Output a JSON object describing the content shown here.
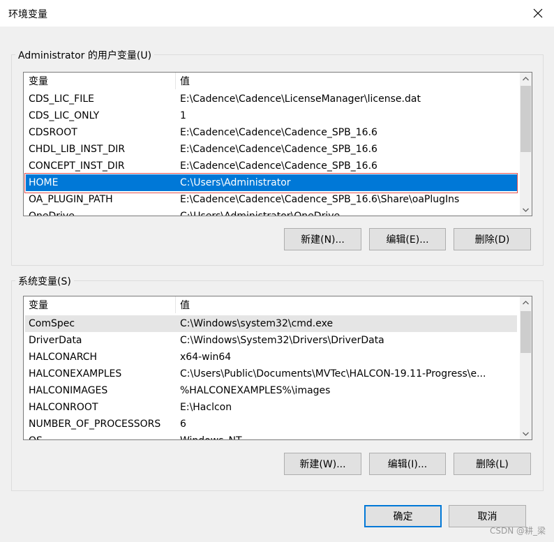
{
  "window": {
    "title": "环境变量"
  },
  "user_vars": {
    "group_label": "Administrator 的用户变量(U)",
    "columns": [
      "变量",
      "值"
    ],
    "rows": [
      {
        "name": "CDS_LIC_FILE",
        "value": "E:\\Cadence\\Cadence\\LicenseManager\\license.dat"
      },
      {
        "name": "CDS_LIC_ONLY",
        "value": "1"
      },
      {
        "name": "CDSROOT",
        "value": "E:\\Cadence\\Cadence\\Cadence_SPB_16.6"
      },
      {
        "name": "CHDL_LIB_INST_DIR",
        "value": "E:\\Cadence\\Cadence\\Cadence_SPB_16.6"
      },
      {
        "name": "CONCEPT_INST_DIR",
        "value": "E:\\Cadence\\Cadence\\Cadence_SPB_16.6"
      },
      {
        "name": "HOME",
        "value": "C:\\Users\\Administrator"
      },
      {
        "name": "OA_PLUGIN_PATH",
        "value": "E:\\Cadence\\Cadence\\Cadence_SPB_16.6\\Share\\oaPlugIns"
      },
      {
        "name": "OneDrive",
        "value": "C:\\Users\\Administrator\\OneDrive"
      }
    ],
    "buttons": {
      "new": "新建(N)...",
      "edit": "编辑(E)...",
      "delete": "删除(D)"
    }
  },
  "system_vars": {
    "group_label": "系统变量(S)",
    "columns": [
      "变量",
      "值"
    ],
    "rows": [
      {
        "name": "ComSpec",
        "value": "C:\\Windows\\system32\\cmd.exe"
      },
      {
        "name": "DriverData",
        "value": "C:\\Windows\\System32\\Drivers\\DriverData"
      },
      {
        "name": "HALCONARCH",
        "value": "x64-win64"
      },
      {
        "name": "HALCONEXAMPLES",
        "value": "C:\\Users\\Public\\Documents\\MVTec\\HALCON-19.11-Progress\\e..."
      },
      {
        "name": "HALCONIMAGES",
        "value": "%HALCONEXAMPLES%\\images"
      },
      {
        "name": "HALCONROOT",
        "value": "E:\\Haclcon"
      },
      {
        "name": "NUMBER_OF_PROCESSORS",
        "value": "6"
      },
      {
        "name": "OS",
        "value": "Windows_NT"
      }
    ],
    "buttons": {
      "new": "新建(W)...",
      "edit": "编辑(I)...",
      "delete": "删除(L)"
    }
  },
  "footer": {
    "ok": "确定",
    "cancel": "取消"
  },
  "watermark": "CSDN @耕_梁",
  "colors": {
    "selection": "#0078d7",
    "focus_outline": "#e05050",
    "default_button_border": "#0078d7"
  }
}
